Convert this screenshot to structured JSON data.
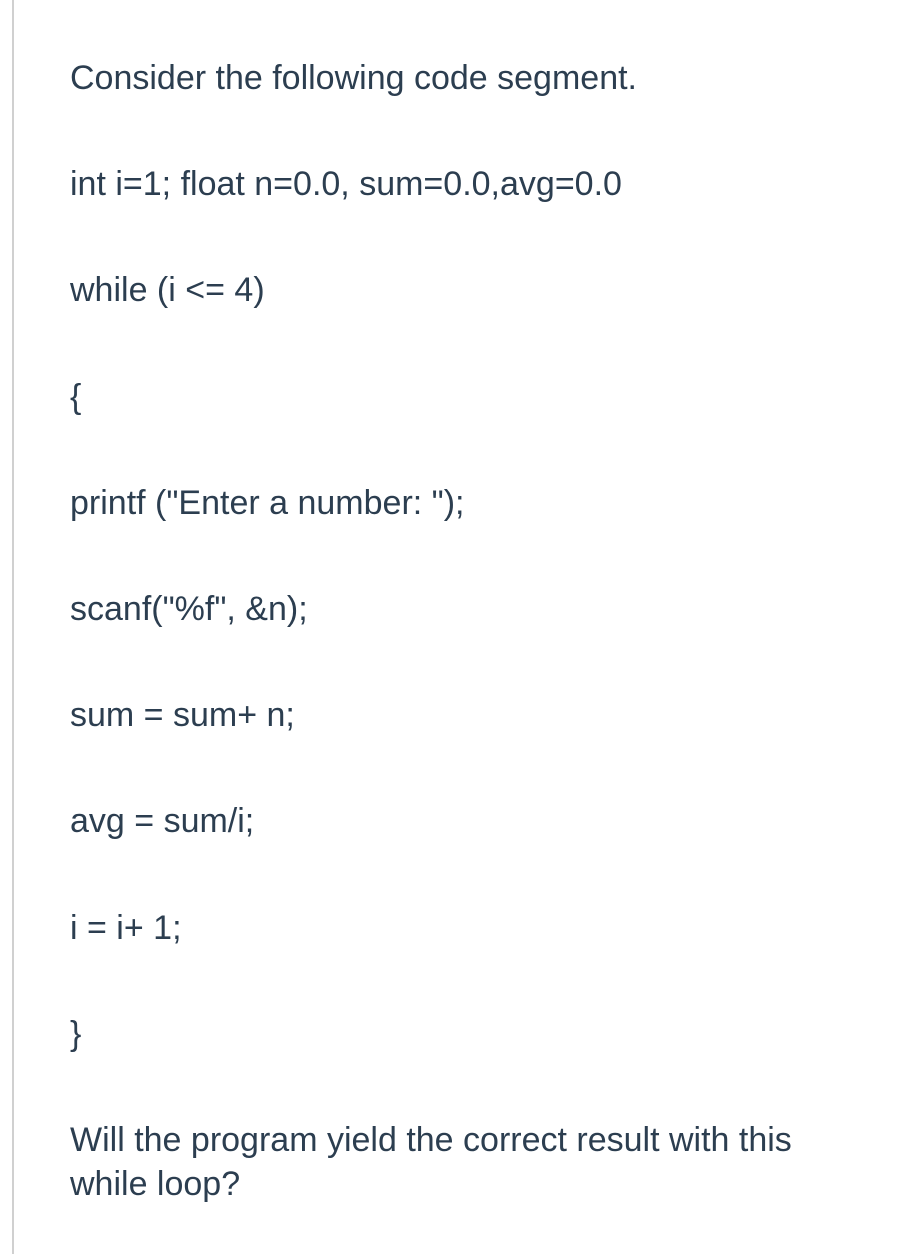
{
  "lines": {
    "l1": "Consider the following code segment.",
    "l2": "int i=1; float n=0.0, sum=0.0,avg=0.0",
    "l3": "while (i <= 4)",
    "l4": "{",
    "l5": "printf (\"Enter a number: \");",
    "l6": "scanf(\"%f\", &n);",
    "l7": "sum = sum+ n;",
    "l8": "avg = sum/i;",
    "l9": "i = i+ 1;",
    "l10": "}",
    "l11": "Will the program yield the correct result with this while loop?"
  }
}
